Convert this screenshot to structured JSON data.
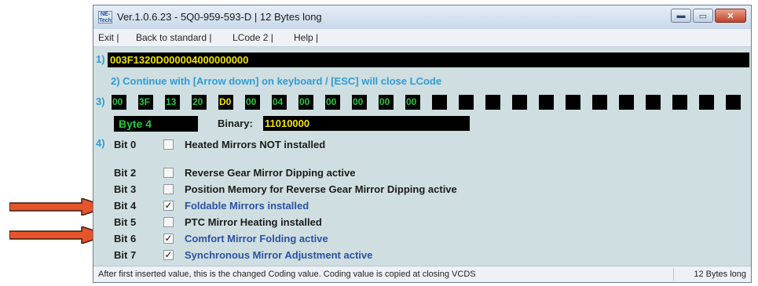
{
  "window": {
    "title": "Ver.1.0.6.23 -   5Q0-959-593-D | 12 Bytes long",
    "icon_text": "NE-Tech",
    "controls": {
      "minimize": "▬",
      "maximize": "▭",
      "close": "✕"
    }
  },
  "menu": [
    "Exit |",
    "Back to standard |",
    "LCode 2 |",
    "Help |"
  ],
  "step_labels": [
    "1)",
    "2)",
    "3)",
    "4)"
  ],
  "coding_value": "003F1320D000004000000000",
  "instruction": "2) Continue with [Arrow down] on keyboard / [ESC] will close LCode",
  "bytes": [
    "00",
    "3F",
    "13",
    "20",
    "D0",
    "00",
    "04",
    "00",
    "00",
    "00",
    "00",
    "00",
    "",
    "",
    "",
    "",
    "",
    "",
    "",
    "",
    "",
    "",
    "",
    ""
  ],
  "selected_byte_index": 4,
  "byte_label": "Byte 4",
  "binary": {
    "label": "Binary:",
    "value": "11010000"
  },
  "bits": [
    {
      "name": "Bit 0",
      "checked": false,
      "desc": "Heated Mirrors NOT installed"
    },
    {
      "name": "Bit 2",
      "checked": false,
      "desc": "Reverse Gear Mirror Dipping active"
    },
    {
      "name": "Bit 3",
      "checked": false,
      "desc": "Position Memory for Reverse Gear Mirror Dipping active"
    },
    {
      "name": "Bit 4",
      "checked": true,
      "desc": "Foldable Mirrors installed"
    },
    {
      "name": "Bit 5",
      "checked": false,
      "desc": "PTC Mirror Heating installed"
    },
    {
      "name": "Bit 6",
      "checked": true,
      "desc": "Comfort Mirror Folding active"
    },
    {
      "name": "Bit 7",
      "checked": true,
      "desc": "Synchronous Mirror Adjustment active"
    }
  ],
  "status": {
    "left": "After first inserted value, this is the changed Coding value.  Coding value is copied at closing VCDS",
    "right": "12 Bytes long"
  },
  "colors": {
    "code_text": "#f1e300",
    "byte_text": "#26c73a",
    "step_label": "#2f9bd6",
    "active_bit": "#2a51a3",
    "arrow": "#e5542a"
  }
}
